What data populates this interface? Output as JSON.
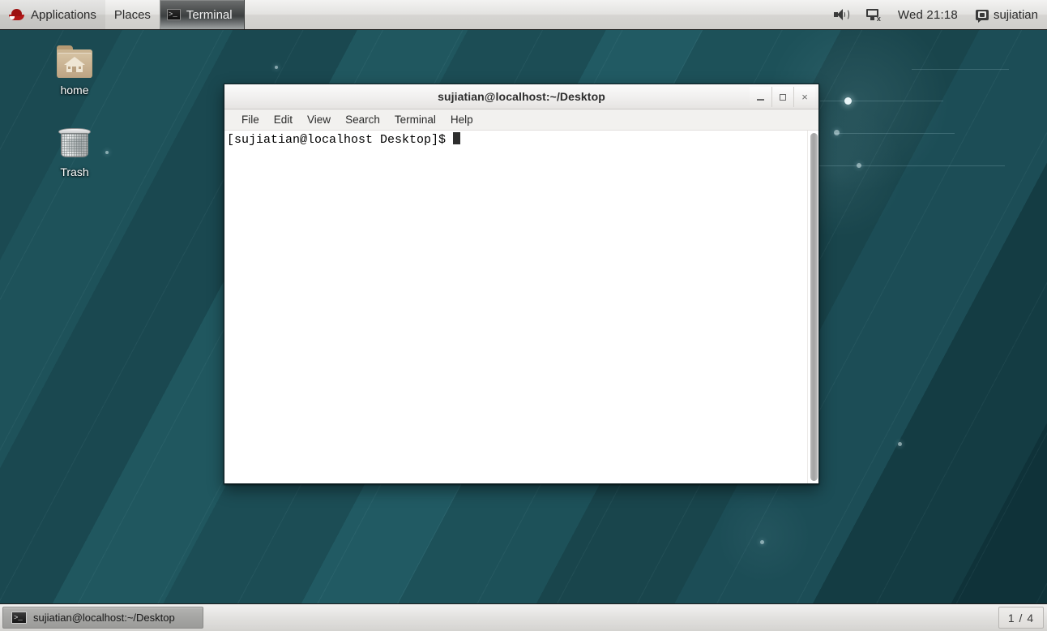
{
  "top_panel": {
    "applications_label": "Applications",
    "places_label": "Places",
    "window_entry_label": "Terminal",
    "clock": "Wed 21:18",
    "user": "sujiatian",
    "icons": {
      "menu_logo": "red-hat-logo",
      "window_entry": "terminal-icon",
      "volume": "speaker-icon",
      "network": "network-disconnected-icon",
      "user": "message-icon"
    }
  },
  "desktop": {
    "icons": [
      {
        "label": "home",
        "glyph": "home-folder-icon"
      },
      {
        "label": "Trash",
        "glyph": "trash-can-icon"
      }
    ]
  },
  "terminal": {
    "title": "sujiatian@localhost:~/Desktop",
    "menus": [
      "File",
      "Edit",
      "View",
      "Search",
      "Terminal",
      "Help"
    ],
    "window_buttons": {
      "minimize": "_",
      "maximize": "□",
      "close": "×"
    },
    "prompt": "[sujiatian@localhost Desktop]$ ",
    "lines": [
      "[sujiatian@localhost Desktop]$ "
    ]
  },
  "bottom_panel": {
    "task_button_label": "sujiatian@localhost:~/Desktop",
    "task_button_icon": "terminal-icon",
    "workspace_indicator": "1 / 4"
  },
  "colors": {
    "desktop_teal": "#1d4f58",
    "panel_gray": "#e3e2e0",
    "accent_red": "#b11818",
    "terminal_bg": "#ffffff",
    "terminal_fg": "#000000"
  }
}
